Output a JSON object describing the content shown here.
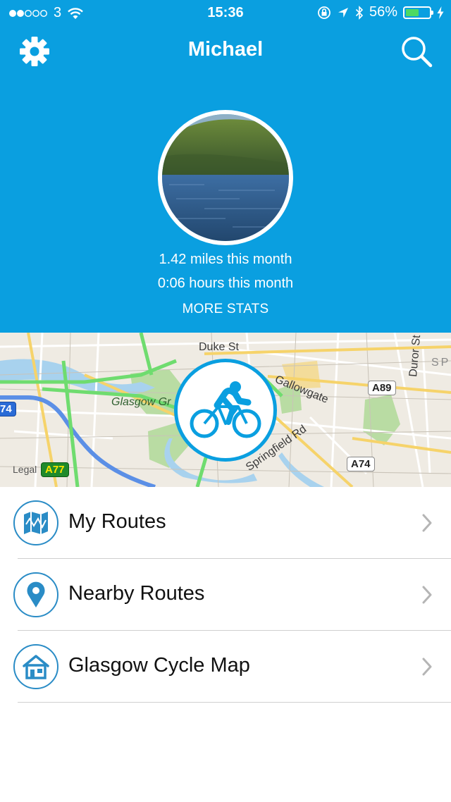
{
  "status_bar": {
    "carrier": "3",
    "time": "15:36",
    "battery": "56%",
    "battery_level": 0.56
  },
  "nav": {
    "title": "Michael",
    "settings_icon": "gear-icon",
    "search_icon": "search-icon"
  },
  "stats": {
    "distance": "1.42 miles this month",
    "time": "0:06 hours this month",
    "more_label": "MORE STATS"
  },
  "map": {
    "labels": {
      "duke_st": "Duke St",
      "gallowgate": "Gallowgate",
      "glasgow_green": "Glasgow Gr",
      "springfield_rd": "Springfield Rd",
      "duror_st": "Duror St",
      "sp": "SP",
      "legal": "Legal"
    },
    "badges": {
      "a89": "A89",
      "a74_right": "A74",
      "a74_left": "74",
      "a77": "A77"
    },
    "colors": {
      "background": "#efebe3",
      "park": "#b9dca3",
      "river": "#a8d2ee",
      "cycle_route": "#6fdc6f",
      "main_road": "#f6d36a",
      "highway": "#5b8fe6"
    }
  },
  "menu": [
    {
      "label": "My Routes",
      "icon": "map-icon"
    },
    {
      "label": "Nearby Routes",
      "icon": "location-pin-icon"
    },
    {
      "label": "Glasgow Cycle Map",
      "icon": "house-icon"
    }
  ],
  "colors": {
    "header": "#0a9fe0",
    "accent": "#2a8cc6"
  }
}
